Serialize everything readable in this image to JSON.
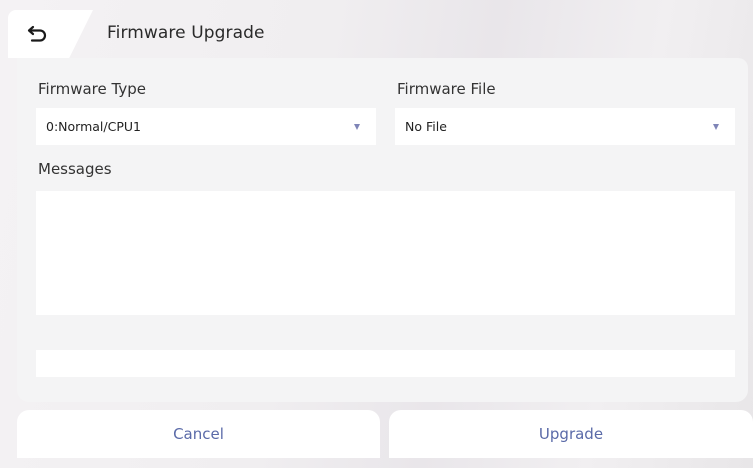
{
  "header": {
    "title": "Firmware Upgrade",
    "back_icon": "back-arrow-icon"
  },
  "firmware_type": {
    "label": "Firmware Type",
    "value": "0:Normal/CPU1"
  },
  "firmware_file": {
    "label": "Firmware File",
    "value": "No File"
  },
  "messages": {
    "label": "Messages",
    "content": ""
  },
  "progress": {
    "value": 0
  },
  "footer": {
    "cancel_label": "Cancel",
    "upgrade_label": "Upgrade"
  },
  "colors": {
    "accent": "#7f85b7",
    "button_text": "#5a6aa8",
    "panel_bg": "#f4f4f5"
  }
}
